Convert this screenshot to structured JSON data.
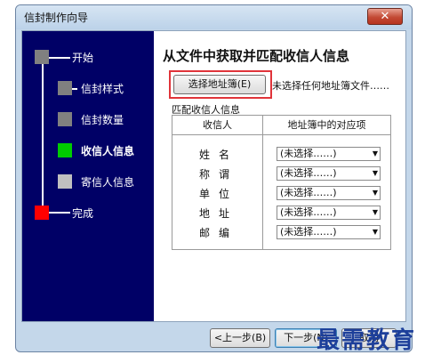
{
  "window": {
    "title": "信封制作向导",
    "close_glyph": "✕"
  },
  "sidebar": {
    "steps": [
      {
        "label": "开始",
        "color": "#808080"
      },
      {
        "label": "信封样式",
        "color": "#808080"
      },
      {
        "label": "信封数量",
        "color": "#808080"
      },
      {
        "label": "收信人信息",
        "color": "#00cc00",
        "active": true
      },
      {
        "label": "寄信人信息",
        "color": "#c0c0c0"
      },
      {
        "label": "完成",
        "color": "#ff0000"
      }
    ]
  },
  "main": {
    "heading": "从文件中获取并匹配收信人信息",
    "choose_button": "选择地址簿(E)",
    "status": "未选择任何地址簿文件……",
    "match_label": "匹配收信人信息",
    "table": {
      "col_recipient": "收信人",
      "col_mapping": "地址簿中的对应项",
      "rows": [
        {
          "field": "姓名",
          "value": "(未选择……)"
        },
        {
          "field": "称谓",
          "value": "(未选择……)"
        },
        {
          "field": "单位",
          "value": "(未选择……)"
        },
        {
          "field": "地址",
          "value": "(未选择……)"
        },
        {
          "field": "邮编",
          "value": "(未选择……)"
        }
      ]
    }
  },
  "footer": {
    "prev_button": "<上一步(B)",
    "next_button": "下一步(N)",
    "cancel_button": "取消"
  },
  "watermark": "最需教育",
  "colors": {
    "sidebar_bg": "#000066",
    "highlight": "#e0343a"
  }
}
